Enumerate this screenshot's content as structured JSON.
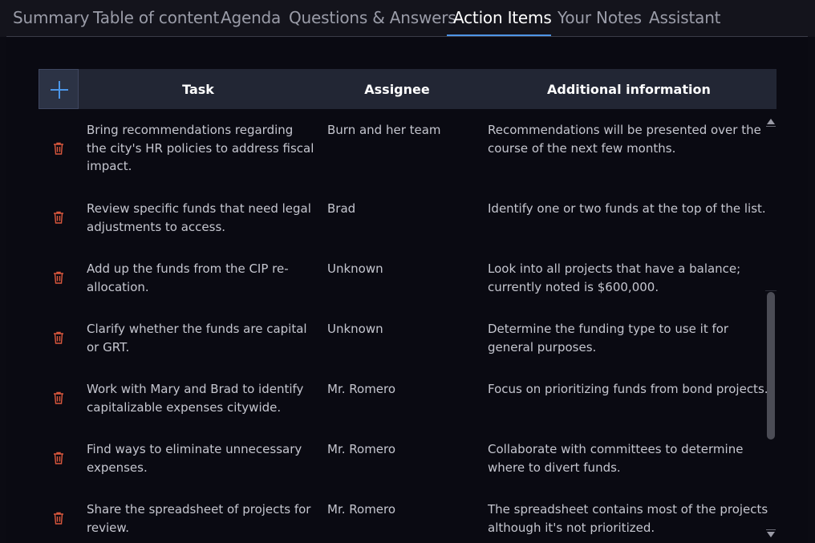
{
  "tabs": [
    {
      "label": "Summary",
      "active": false
    },
    {
      "label": "Table of content",
      "active": false
    },
    {
      "label": "Agenda",
      "active": false
    },
    {
      "label": "Questions & Answers",
      "active": false
    },
    {
      "label": "Action Items",
      "active": true
    },
    {
      "label": "Your Notes",
      "active": false
    },
    {
      "label": "Assistant",
      "active": false
    }
  ],
  "table": {
    "headers": {
      "task": "Task",
      "assignee": "Assignee",
      "info": "Additional information"
    },
    "rows": [
      {
        "task": "Bring recommendations regarding the city's HR policies to address fiscal impact.",
        "assignee": "Burn and her team",
        "info": "Recommendations will be presented over the course of the next few months."
      },
      {
        "task": "Review specific funds that need legal adjustments to access.",
        "assignee": "Brad",
        "info": "Identify one or two funds at the top of the list."
      },
      {
        "task": "Add up the funds from the CIP re-allocation.",
        "assignee": "Unknown",
        "info": "Look into all projects that have a balance; currently noted is $600,000."
      },
      {
        "task": "Clarify whether the funds are capital or GRT.",
        "assignee": "Unknown",
        "info": "Determine the funding type to use it for general purposes."
      },
      {
        "task": "Work with Mary and Brad to identify capitalizable expenses citywide.",
        "assignee": "Mr. Romero",
        "info": "Focus on prioritizing funds from bond projects."
      },
      {
        "task": "Find ways to eliminate unnecessary expenses.",
        "assignee": "Mr. Romero",
        "info": "Collaborate with committees to determine where to divert funds."
      },
      {
        "task": "Share the spreadsheet of projects for review.",
        "assignee": "Mr. Romero",
        "info": "The spreadsheet contains most of the projects although it's not prioritized."
      }
    ]
  },
  "icons": {
    "add": "plus-icon",
    "delete": "trash-icon",
    "scroll_up": "triangle-up-icon",
    "scroll_down": "triangle-down-icon"
  },
  "colors": {
    "accent": "#4e95e6",
    "trash": "#d9573d",
    "header_bg": "#222634"
  }
}
